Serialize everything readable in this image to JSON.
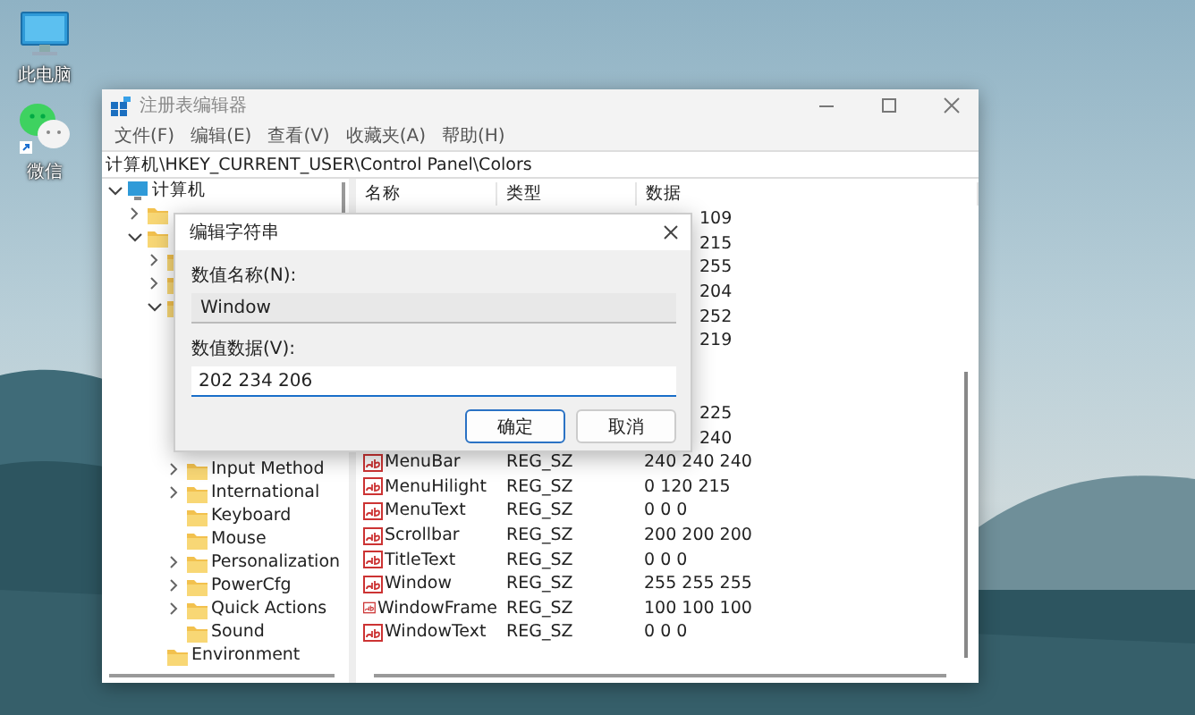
{
  "desktop_icons": [
    {
      "label": "此电脑",
      "kind": "computer"
    },
    {
      "label": "微信",
      "kind": "chat"
    }
  ],
  "window": {
    "title": "注册表编辑器",
    "menu": [
      "文件(F)",
      "编辑(E)",
      "查看(V)",
      "收藏夹(A)",
      "帮助(H)"
    ],
    "address": "计算机\\HKEY_CURRENT_USER\\Control Panel\\Colors"
  },
  "tree": {
    "label": "计算机",
    "expanded": true,
    "children": [
      {
        "expanded": false
      },
      {
        "expanded": true,
        "children": [
          {
            "expanded": false
          },
          {
            "expanded": false
          },
          {
            "expanded": true,
            "children": [
              {
                "kind": "covered"
              },
              {
                "kind": "covered"
              },
              {
                "kind": "covered"
              },
              {
                "kind": "covered"
              },
              {
                "kind": "covered"
              },
              {
                "kind": "covered"
              },
              {
                "label": "Input Method",
                "expanded": false
              },
              {
                "label": "International",
                "expanded": false
              },
              {
                "label": "Keyboard"
              },
              {
                "label": "Mouse"
              },
              {
                "label": "Personalization",
                "expanded": false
              },
              {
                "label": "PowerCfg",
                "expanded": false
              },
              {
                "label": "Quick Actions",
                "expanded": false
              },
              {
                "label": "Sound"
              }
            ]
          },
          {
            "label": "Environment"
          }
        ]
      }
    ]
  },
  "list": {
    "columns": [
      "名称",
      "类型",
      "数据"
    ],
    "rows": [
      {
        "kind": "partial",
        "data": "109"
      },
      {
        "kind": "partial",
        "data": "215"
      },
      {
        "kind": "partial",
        "data": "255"
      },
      {
        "kind": "partial",
        "data": "204"
      },
      {
        "kind": "partial",
        "data": "252"
      },
      {
        "kind": "partial",
        "data": "219"
      },
      {
        "kind": "hidden"
      },
      {
        "kind": "hidden"
      },
      {
        "kind": "partial",
        "data": "225"
      },
      {
        "kind": "partial",
        "data": "240"
      },
      {
        "kind": "full",
        "name": "MenuBar",
        "type": "REG_SZ",
        "data": "240 240 240"
      },
      {
        "kind": "full",
        "name": "MenuHilight",
        "type": "REG_SZ",
        "data": "0 120 215"
      },
      {
        "kind": "full",
        "name": "MenuText",
        "type": "REG_SZ",
        "data": "0 0 0"
      },
      {
        "kind": "full",
        "name": "Scrollbar",
        "type": "REG_SZ",
        "data": "200 200 200"
      },
      {
        "kind": "full",
        "name": "TitleText",
        "type": "REG_SZ",
        "data": "0 0 0"
      },
      {
        "kind": "full",
        "name": "Window",
        "type": "REG_SZ",
        "data": "255 255 255"
      },
      {
        "kind": "full",
        "name": "WindowFrame",
        "type": "REG_SZ",
        "data": "100 100 100"
      },
      {
        "kind": "full",
        "name": "WindowText",
        "type": "REG_SZ",
        "data": "0 0 0"
      }
    ]
  },
  "dialog": {
    "title": "编辑字符串",
    "name_label": "数值名称(N):",
    "name_value": "Window",
    "data_label": "数值数据(V):",
    "data_value": "202 234 206",
    "buttons": [
      {
        "label": "确定",
        "default": true
      },
      {
        "label": "取消",
        "default": false
      }
    ]
  }
}
